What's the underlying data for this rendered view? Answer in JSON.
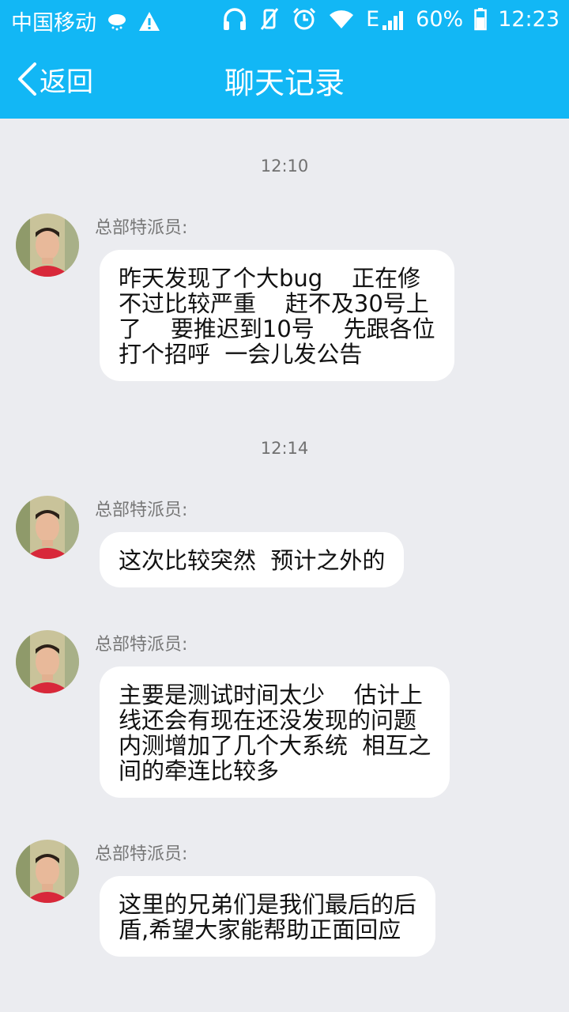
{
  "statusbar": {
    "carrier": "中国移动",
    "network": "E",
    "battery": "60%",
    "time": "12:23",
    "icons": [
      "weather-rain-icon",
      "warning-icon",
      "headphones-icon",
      "vibrate-off-icon",
      "alarm-icon",
      "wifi-icon",
      "signal-icon",
      "battery-icon"
    ]
  },
  "navbar": {
    "back_label": "返回",
    "title": "聊天记录"
  },
  "colors": {
    "header_bg": "#12b7f5",
    "chat_bg": "#ebecf0",
    "bubble_bg": "#ffffff"
  },
  "chat": {
    "timestamps": [
      "12:10",
      "12:14"
    ],
    "messages": [
      {
        "sender": "总部特派员:",
        "text": "昨天发现了个大bug    正在修\n不过比较严重    赶不及30号上\n了    要推迟到10号    先跟各位\n打个招呼  一会儿发公告"
      },
      {
        "sender": "总部特派员:",
        "text": "这次比较突然  预计之外的"
      },
      {
        "sender": "总部特派员:",
        "text": "主要是测试时间太少    估计上\n线还会有现在还没发现的问题\n内测增加了几个大系统  相互之\n间的牵连比较多"
      },
      {
        "sender": "总部特派员:",
        "text": "这里的兄弟们是我们最后的后\n盾,希望大家能帮助正面回应"
      }
    ]
  }
}
